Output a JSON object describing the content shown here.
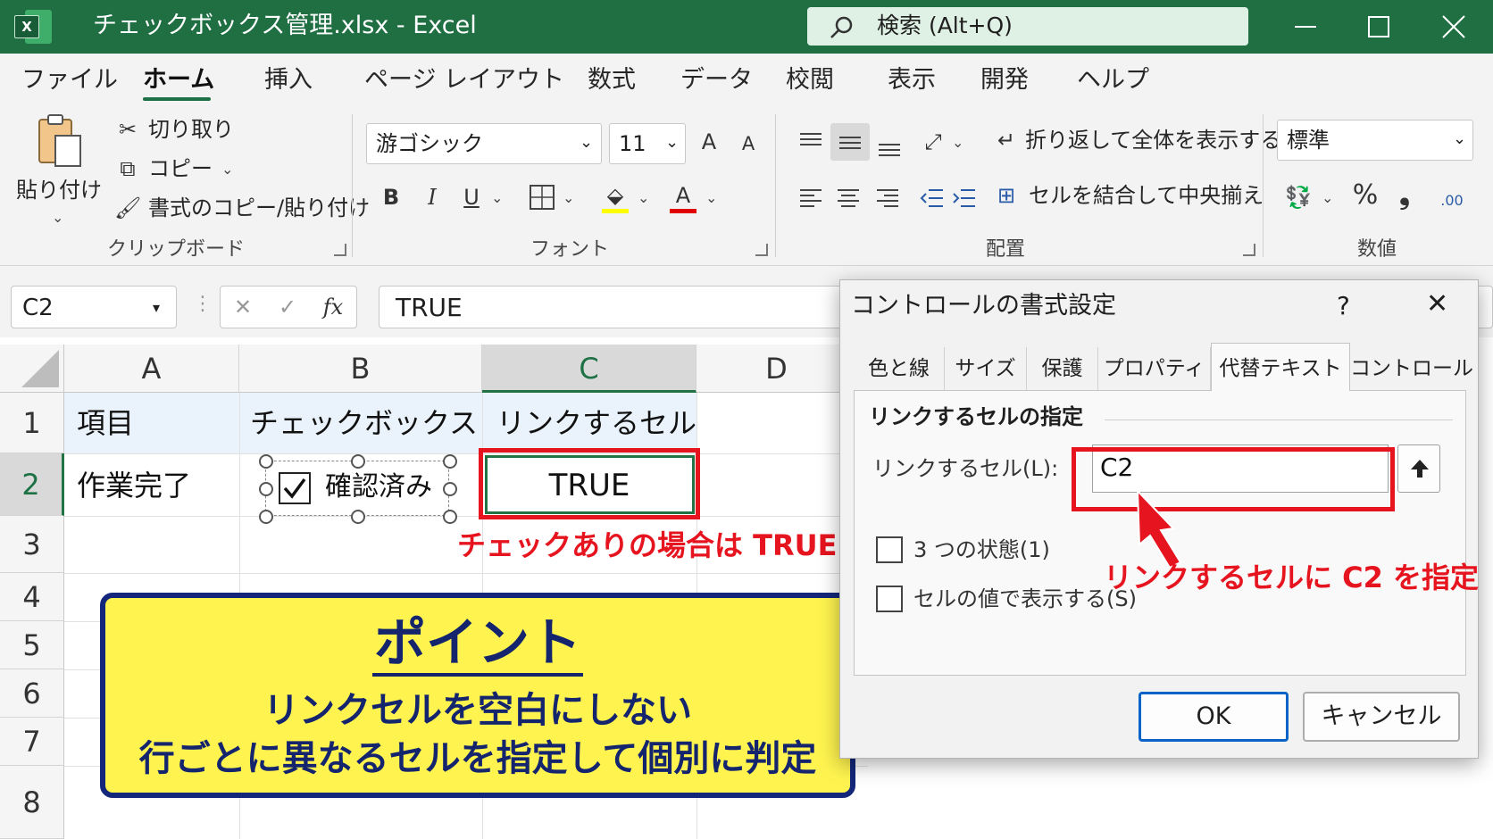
{
  "title_bar": {
    "app_icon_letter": "X",
    "document_title": "チェックボックス管理.xlsx  -  Excel",
    "search_text": "検索 (Alt+Q)"
  },
  "ribbon_tabs": [
    "ファイル",
    "ホーム",
    "挿入",
    "ページ レイアウト",
    "数式",
    "データ",
    "校閲",
    "表示",
    "開発",
    "ヘルプ"
  ],
  "active_tab": "ホーム",
  "clipboard": {
    "paste_label": "貼り付け",
    "cut_label": "切り取り",
    "copy_label": "コピー",
    "format_painter_label": "書式のコピー/貼り付け",
    "group_label": "クリップボード"
  },
  "font_group": {
    "font_name": "游ゴシック",
    "font_size": "11",
    "bold": "B",
    "italic": "I",
    "underline": "U",
    "font_color_letter": "A",
    "increase_font": "A",
    "decrease_font": "A",
    "group_label": "フォント",
    "highlight_color": "#ffff00",
    "font_color": "#e00000"
  },
  "alignment": {
    "wrap_text_label": "折り返して全体を表示する",
    "merge_center_label": "セルを結合して中央揃え",
    "group_label": "配置"
  },
  "number_group": {
    "format": "標準",
    "percent": "%",
    "comma": "❟",
    "decimal_increase": ".00",
    "group_label": "数値"
  },
  "formula_bar": {
    "name_box": "C2",
    "cancel_icon": "✕",
    "enter_icon": "✓",
    "fx_label": "fx",
    "formula": "TRUE"
  },
  "sheet": {
    "columns": [
      "A",
      "B",
      "C",
      "D"
    ],
    "rows": [
      "1",
      "2",
      "3",
      "4",
      "5",
      "6",
      "7",
      "8"
    ],
    "header_row": [
      "項目",
      "チェックボックス",
      "リンクするセル"
    ],
    "row2": {
      "a": "作業完了",
      "checkbox_label": "確認済み",
      "checkbox_checked": true,
      "c": "TRUE"
    },
    "selected_cell": "C2"
  },
  "annotations": {
    "true_note": "チェックありの場合は TRUE",
    "link_note": "リンクするセルに C2 を指定",
    "point_title": "ポイント",
    "point_line1": "リンクセルを空白にしない",
    "point_line2": "行ごとに異なるセルを指定して個別に判定",
    "accent_color": "#e6141e",
    "point_bg": "#fff44f",
    "point_border": "#13267a"
  },
  "dialog": {
    "title": "コントロールの書式設定",
    "help": "?",
    "close": "✕",
    "tabs": [
      "色と線",
      "サイズ",
      "保護",
      "プロパティ",
      "代替テキスト",
      "コントロール"
    ],
    "active_tab": "代替テキスト",
    "section_title": "リンクするセルの指定",
    "link_label": "リンクするセル(L):",
    "link_value": "C2",
    "three_state_label": "3 つの状態(1)",
    "display_value_label": "セルの値で表示する(S)",
    "ok": "OK",
    "cancel": "キャンセル"
  }
}
